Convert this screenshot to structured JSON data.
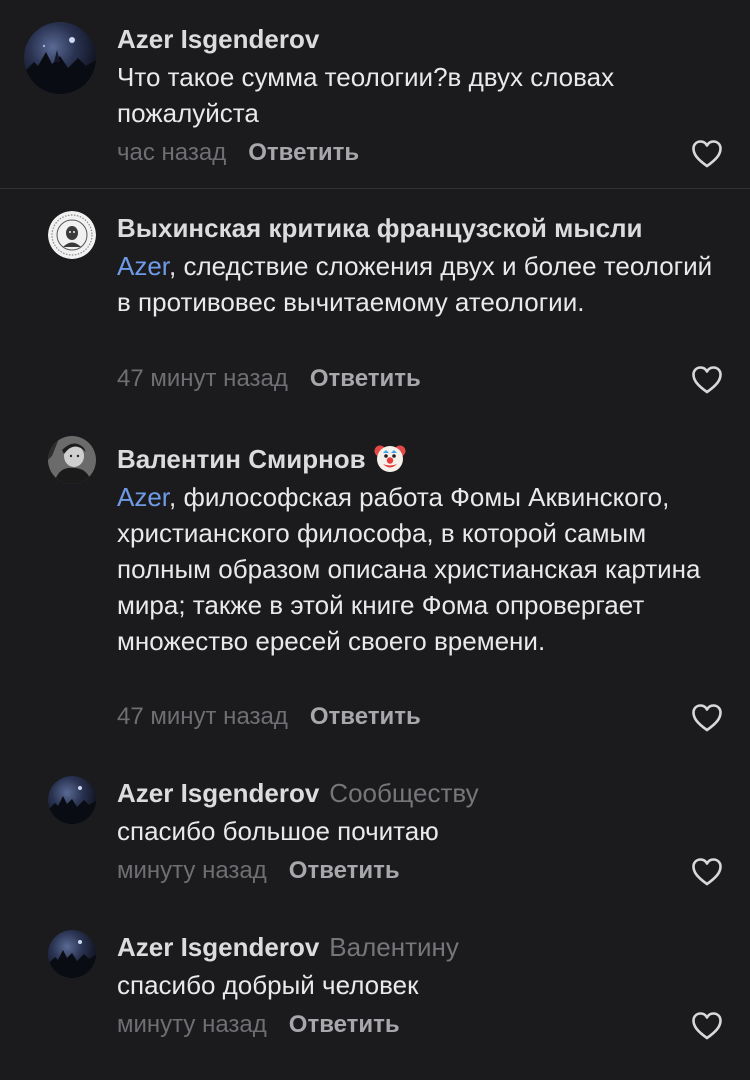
{
  "comments": [
    {
      "author": "Azer Isgenderov",
      "text": "Что такое сумма теологии?в двух словах пожалуйста",
      "time": "час назад",
      "reply_label": "Ответить"
    },
    {
      "author": "Выхинская критика французской мысли",
      "mention": "Azer",
      "text": ", следствие сложения двух и более теологий в противовес вычитаемому атеологии.",
      "time": "47 минут назад",
      "reply_label": "Ответить"
    },
    {
      "author": "Валентин Смирнов",
      "emoji": "clown-face",
      "mention": "Azer",
      "text": ", философская работа Фомы Аквинского, христианского философа, в которой самым полным образом описана христианская картина мира; также в этой книге Фома опровергает множество ересей своего времени.",
      "time": "47 минут назад",
      "reply_label": "Ответить"
    },
    {
      "author": "Azer Isgenderov",
      "reply_to": "Сообществу",
      "text": "спасибо большое почитаю",
      "time": "минуту назад",
      "reply_label": "Ответить"
    },
    {
      "author": "Azer Isgenderov",
      "reply_to": "Валентину",
      "text": "спасибо добрый человек",
      "time": "минуту назад",
      "reply_label": "Ответить"
    }
  ],
  "colors": {
    "background": "#1b1b1d",
    "mention": "#6f9be6",
    "secondary_text": "#6f6f73",
    "reply_button": "#a8a8ac"
  },
  "icons": {
    "like": "heart-outline-icon",
    "emoji": "clown-face"
  }
}
